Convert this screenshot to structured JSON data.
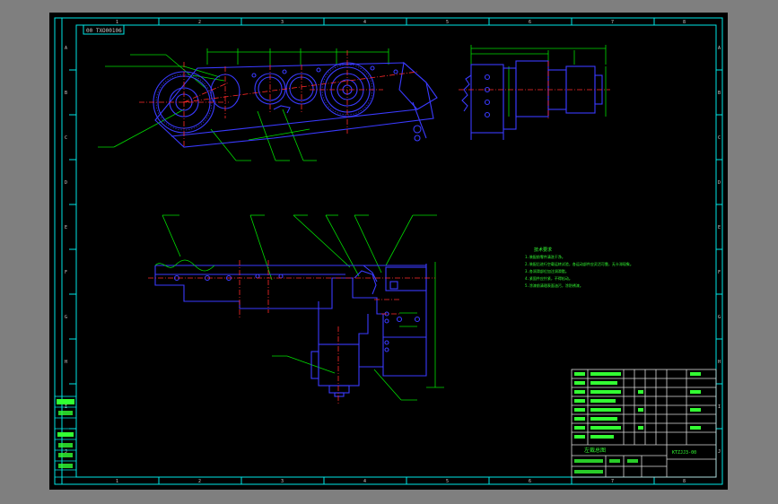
{
  "drawing": {
    "code_box": "00 TXO00106",
    "sheet_name": "左裁总图",
    "part_code": "KTZJJ3-00",
    "colors": {
      "background": "#000000",
      "frame": "#00e6e6",
      "outline": "#3a3aff",
      "center_line": "#ff2a2a",
      "dimension": "#00dd00",
      "text": "#33ff33"
    }
  },
  "column_labels": [
    "1",
    "2",
    "3",
    "4",
    "5",
    "6",
    "7",
    "8"
  ],
  "row_labels": [
    "A",
    "B",
    "C",
    "D",
    "E",
    "F",
    "G",
    "H",
    "I",
    "J"
  ],
  "notes": {
    "title": "技术要求",
    "lines": [
      "1.装配前零件清洗干净。",
      "2.装配后进行空载运转试验，各运动部件应灵活可靠，无卡滞现象。",
      "3.各润滑部位加注润滑脂。",
      "4.紧固件应拧紧，不得松动。",
      "5.涂漆前清理表面油污，涂防锈漆。"
    ]
  }
}
